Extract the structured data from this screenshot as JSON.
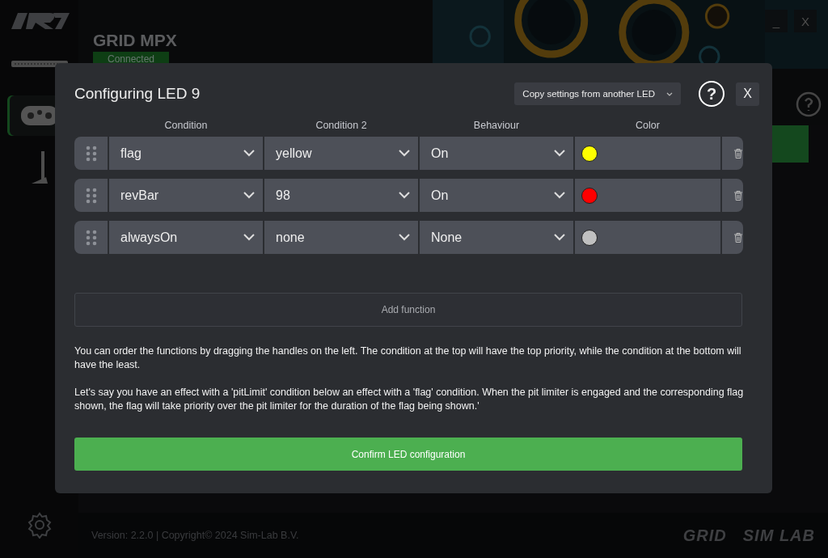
{
  "app": {
    "device": {
      "name": "GRID MPX",
      "status": "Connected"
    },
    "window_buttons": [
      "_",
      "X"
    ],
    "sidebar": {
      "items": [
        {
          "selected": false
        },
        {
          "selected": true
        },
        {
          "selected": false
        }
      ]
    },
    "footer": {
      "version": "Version: 2.2.0 | Copyright© 2024 Sim-Lab B.V.",
      "brands": [
        "GRID",
        "SIM LAB"
      ]
    }
  },
  "dialog": {
    "title": "Configuring LED 9",
    "copy_dropdown": "Copy settings from another LED",
    "help": "?",
    "close": "X",
    "columns": [
      "Condition",
      "Condition 2",
      "Behaviour",
      "Color"
    ],
    "rows": [
      {
        "condition": "flag",
        "condition_2": "yellow",
        "behaviour": "On",
        "color": "#ffff00"
      },
      {
        "condition": "revBar",
        "condition_2": "98",
        "behaviour": "On",
        "color": "#ff0000"
      },
      {
        "condition": "alwaysOn",
        "condition_2": "none",
        "behaviour": "None",
        "color": "#c0c0c0"
      }
    ],
    "add_button": "Add function",
    "paragraphs": [
      "You can order the functions by dragging the handles on the left. The condition at the top will have the top priority, while the condition at the bottom will have the least.",
      "Let's say you have an effect with a 'pitLimit' condition below an effect with a 'flag' condition. When the pit limiter is engaged and the corresponding flag shown, the flag will take priority over the pit limiter for the duration of the flag being shown.'"
    ],
    "confirm_button": "Confirm LED configuration"
  }
}
